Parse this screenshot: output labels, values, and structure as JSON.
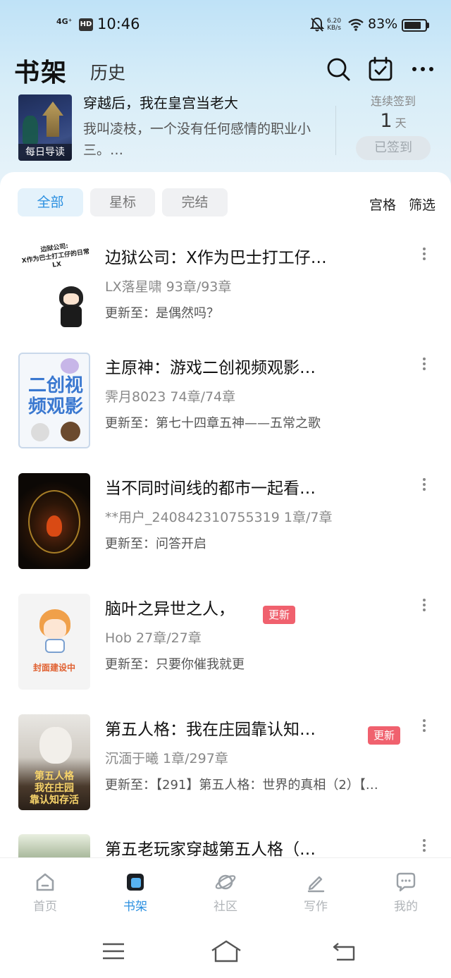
{
  "status_bar": {
    "network": "4G⁺",
    "hd": "HD",
    "time": "10:46",
    "speed_value": "6.20",
    "speed_unit": "KB/s",
    "battery": "83%",
    "battery_level": 0.83
  },
  "header": {
    "tab_bookshelf": "书架",
    "tab_history": "历史",
    "search_icon": "search-icon",
    "calendar_icon": "calendar-check-icon",
    "more_icon": "more-horizontal-icon"
  },
  "daily_read": {
    "badge": "每日导读",
    "title": "穿越后，我在皇宫当老大",
    "desc": "我叫凌枝，一个没有任何感情的职业小三。…",
    "sign_label": "连续签到",
    "sign_days": "1",
    "sign_unit": "天",
    "sign_button": "已签到"
  },
  "filters": {
    "all": "全部",
    "starred": "星标",
    "finished": "完结",
    "grid": "宫格",
    "filter": "筛选"
  },
  "books": [
    {
      "title": "边狱公司：X作为巴士打工仔…",
      "meta": "LX落星啸  93章/93章",
      "update": "更新至：是偶然吗？",
      "cover_text": "边狱公司:\nX作为巴士打工仔的日常\nLX",
      "new_badge": ""
    },
    {
      "title": "主原神：游戏二创视频观影…",
      "meta": "霁月8023  74章/74章",
      "update": "更新至：第七十四章五神——五常之歌",
      "cover_text": "二创视频观影",
      "new_badge": ""
    },
    {
      "title": "当不同时间线的都市一起看…",
      "meta": "**用户_240842310755319  1章/7章",
      "update": "更新至：问答开启",
      "new_badge": ""
    },
    {
      "title": "脑叶之异世之人，",
      "meta": "Hob  27章/27章",
      "update": "更新至：只要你催我就更",
      "cover_text": "封面建设中",
      "new_badge": "更新"
    },
    {
      "title": "第五人格：我在庄园靠认知…",
      "meta": "沉湎于曦  1章/297章",
      "update": "更新至：【291】第五人格：世界的真相（2）【…",
      "cover_text": "第五人格\n我在庄园\n靠认知存活",
      "new_badge": "更新"
    },
    {
      "title": "第五老玩家穿越第五人格（…",
      "meta": "",
      "update": "",
      "new_badge": ""
    }
  ],
  "bottom_nav": [
    {
      "label": "首页",
      "icon": "home-icon"
    },
    {
      "label": "书架",
      "icon": "bookshelf-icon"
    },
    {
      "label": "社区",
      "icon": "planet-icon"
    },
    {
      "label": "写作",
      "icon": "pen-icon"
    },
    {
      "label": "我的",
      "icon": "chat-bubble-icon"
    }
  ],
  "system_nav": {
    "menu_icon": "menu-icon",
    "home_icon": "system-home-icon",
    "back_icon": "back-icon"
  },
  "colors": {
    "accent": "#2a8fe0",
    "new_badge": "#f0616e",
    "header_gradient_top": "#bfe2f7"
  }
}
